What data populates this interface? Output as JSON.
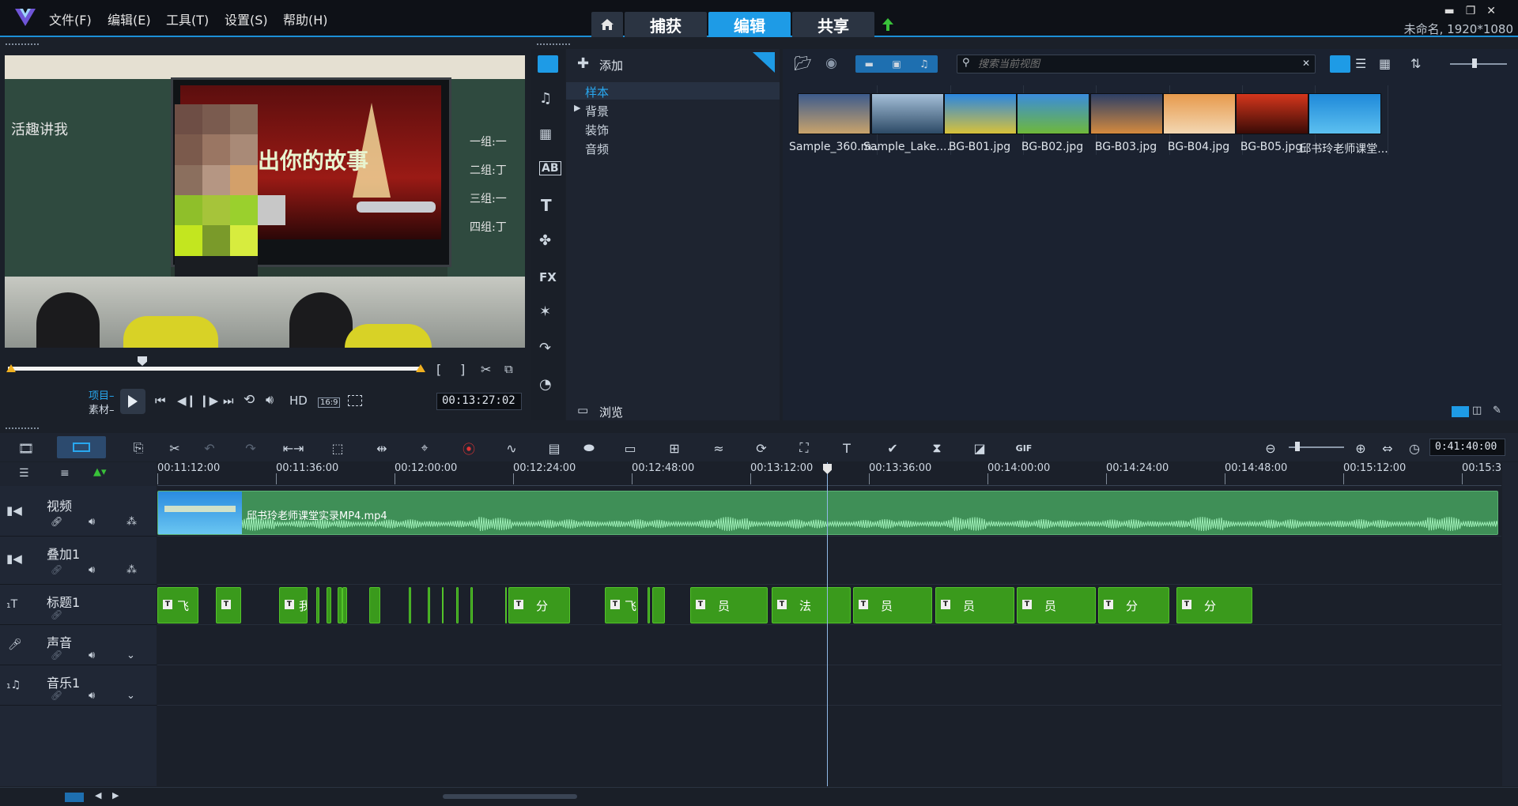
{
  "menus": [
    "文件(F)",
    "编辑(E)",
    "工具(T)",
    "设置(S)",
    "帮助(H)"
  ],
  "nav": {
    "home": "home-icon",
    "tabs": [
      "捕获",
      "编辑",
      "共享"
    ],
    "active": 1
  },
  "project_info": "未命名, 1920*1080",
  "preview": {
    "slide_text": "出你的故事",
    "board_left": "活趣讲我",
    "board_right": [
      "一组:一",
      "二组:丁",
      "三组:一",
      "四组:丁"
    ],
    "mode_project": "项目",
    "mode_clip": "素材",
    "hd_label": "HD",
    "ratio": "16:9",
    "timecode": "00:13:27:02"
  },
  "library": {
    "add_label": "添加",
    "tree": [
      "样本",
      "背景",
      "装饰",
      "音频"
    ],
    "browse_label": "浏览",
    "search_placeholder": "搜索当前视图",
    "thumbnails": [
      {
        "name": "Sample_360.m...",
        "colors": [
          "#3d5b8d",
          "#c9a36b"
        ]
      },
      {
        "name": "Sample_Lake....",
        "colors": [
          "#a4bfd8",
          "#2d4a66"
        ]
      },
      {
        "name": "BG-B01.jpg",
        "colors": [
          "#2a86e0",
          "#d8c23a"
        ]
      },
      {
        "name": "BG-B02.jpg",
        "colors": [
          "#3a8cdc",
          "#6fb83a"
        ]
      },
      {
        "name": "BG-B03.jpg",
        "colors": [
          "#2d3f66",
          "#d58a3e"
        ]
      },
      {
        "name": "BG-B04.jpg",
        "colors": [
          "#e79a4d",
          "#f3d7b2"
        ]
      },
      {
        "name": "BG-B05.jpg",
        "colors": [
          "#d5361c",
          "#3a0b06"
        ]
      },
      {
        "name": "邱书玲老师课堂...",
        "colors": [
          "#1f89d9",
          "#5cc0f0"
        ]
      }
    ]
  },
  "timeline": {
    "timecode": "0:41:40:00",
    "ruler": [
      "00:11:12:00",
      "00:11:36:00",
      "00:12:00:00",
      "00:12:24:00",
      "00:12:48:00",
      "00:13:12:00",
      "00:13:36:00",
      "00:14:00:00",
      "00:14:24:00",
      "00:14:48:00",
      "00:15:12:00",
      "00:15:3"
    ],
    "tracks": [
      "视频",
      "叠加1",
      "标题1",
      "声音",
      "音乐1"
    ],
    "video_clip": "邱书玲老师课堂实录MP4.mp4",
    "title_clips": [
      {
        "label": "飞"
      },
      {
        "label": ""
      },
      {
        "label": "我"
      },
      {
        "label": ""
      },
      {
        "label": ""
      },
      {
        "label": ""
      },
      {
        "label": ""
      },
      {
        "label": ""
      },
      {
        "label": "分"
      },
      {
        "label": "飞"
      },
      {
        "label": ""
      },
      {
        "label": "员"
      },
      {
        "label": "法"
      },
      {
        "label": "员"
      },
      {
        "label": "员"
      },
      {
        "label": "员"
      },
      {
        "label": "分"
      },
      {
        "label": "分"
      }
    ],
    "colors": {
      "accent": "#1e9be6",
      "title_clip": "#3a9a1c",
      "video_clip": "#3f8f57"
    }
  }
}
